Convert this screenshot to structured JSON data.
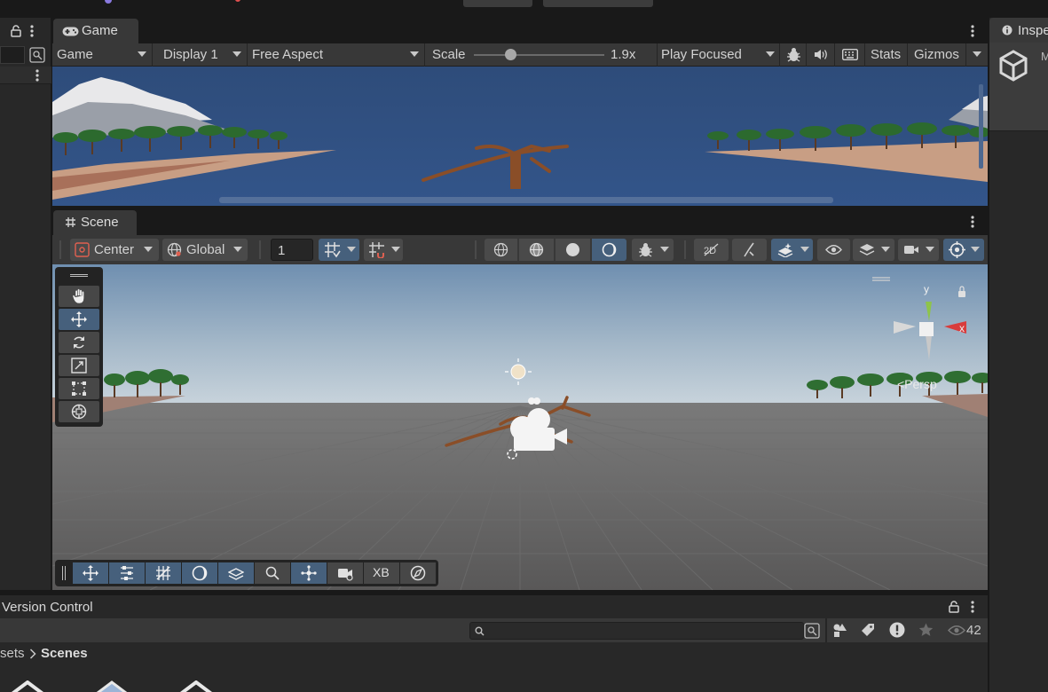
{
  "game_panel": {
    "tab_label": "Game",
    "display_mode": "Game",
    "display": "Display 1",
    "aspect": "Free Aspect",
    "scale_label": "Scale",
    "scale_value": "1.9x",
    "scale_fraction": 0.28,
    "play_mode": "Play Focused",
    "stats_label": "Stats",
    "gizmos_label": "Gizmos"
  },
  "scene_panel": {
    "tab_label": "Scene",
    "pivot": "Center",
    "space": "Global",
    "snap_value": "1",
    "persp_label": "<Persp",
    "overlay_xb": "XB",
    "gizmo_axes": {
      "y": "y",
      "x": "x"
    }
  },
  "bottom_panel": {
    "title": "Version Control",
    "breadcrumb": [
      "sets",
      "Scenes"
    ],
    "visibility_count": "42"
  },
  "inspector": {
    "title": "Inspe",
    "sub": "M"
  },
  "colors": {
    "accent": "#46607c",
    "panel": "#383838",
    "dark": "#282828",
    "sky": "#2f4f7f"
  }
}
